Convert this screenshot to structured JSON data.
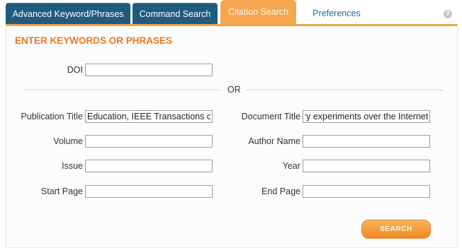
{
  "tabs": [
    {
      "label": "Advanced Keyword/Phrases"
    },
    {
      "label": "Command Search"
    },
    {
      "label": "Citation Search"
    },
    {
      "label": "Preferences"
    }
  ],
  "active_tab": "Citation Search",
  "help_icon": {
    "glyph": "?"
  },
  "panel": {
    "title": "ENTER KEYWORDS OR PHRASES",
    "doi": {
      "label": "DOI",
      "value": ""
    },
    "or_text": "OR",
    "publication_title": {
      "label": "Publication Title",
      "value": "Education, IEEE Transactions on"
    },
    "document_title": {
      "label": "Document Title",
      "value": "ory experiments over the Internet"
    },
    "volume": {
      "label": "Volume",
      "value": ""
    },
    "author_name": {
      "label": "Author Name",
      "value": ""
    },
    "issue": {
      "label": "Issue",
      "value": ""
    },
    "year": {
      "label": "Year",
      "value": ""
    },
    "start_page": {
      "label": "Start Page",
      "value": ""
    },
    "end_page": {
      "label": "End Page",
      "value": ""
    },
    "search_label": "SEARCH"
  },
  "colors": {
    "tab_dark": "#1f5b7c",
    "tab_active": "#f5a64f",
    "accent_orange": "#e87722",
    "link_blue": "#1f6a9a"
  }
}
